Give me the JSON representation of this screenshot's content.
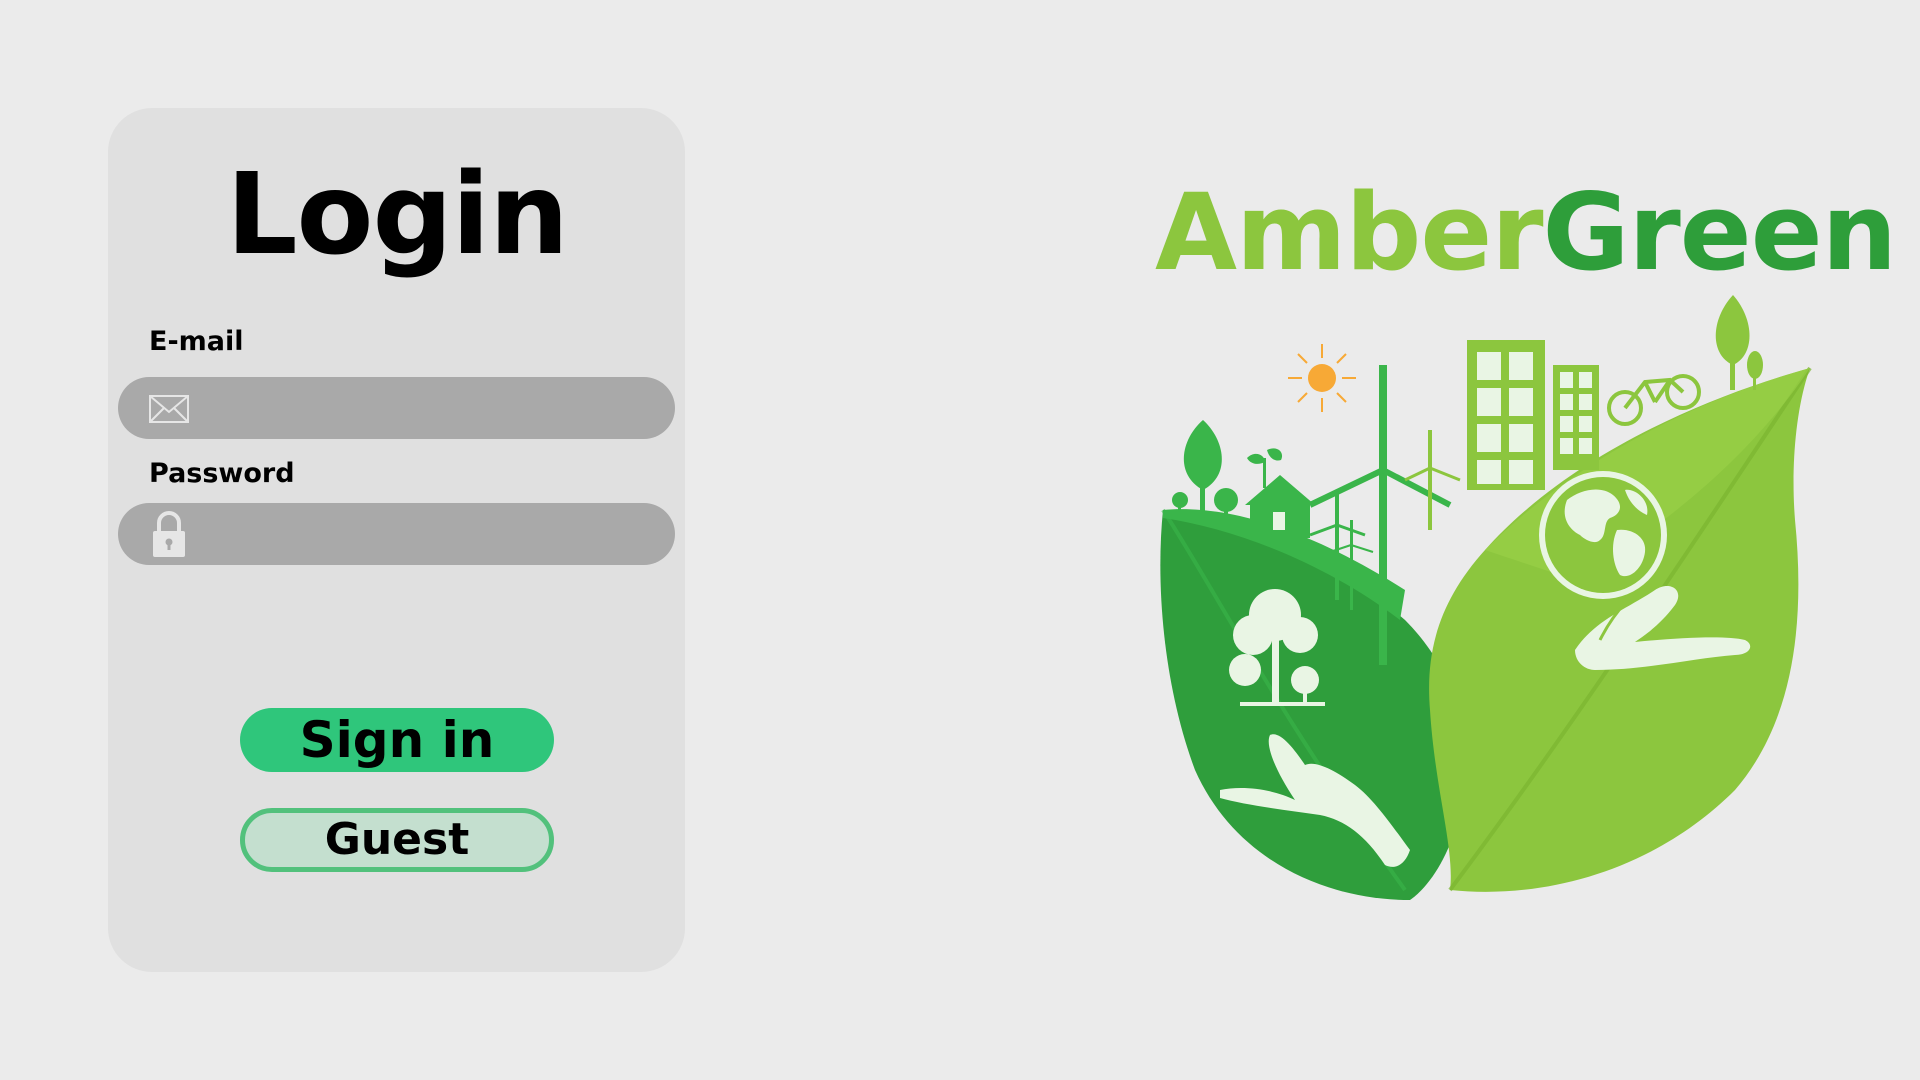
{
  "login": {
    "title": "Login",
    "email_label": "E-mail",
    "email_value": "",
    "password_label": "Password",
    "password_value": "",
    "signin_label": "Sign in",
    "guest_label": "Guest",
    "email_icon": "envelope-icon",
    "password_icon": "lock-icon"
  },
  "brand": {
    "part1": "Amber",
    "part2": "Green",
    "logo": "eco-leaves-logo"
  },
  "colors": {
    "background": "#ebebeb",
    "card": "#e0e0e0",
    "input": "#a9a9a9",
    "signin": "#2fc67b",
    "guest_fill": "#c4dfcf",
    "guest_border": "#52c17c",
    "brand_amber": "#8cc63e",
    "brand_green": "#2e9e3a"
  }
}
